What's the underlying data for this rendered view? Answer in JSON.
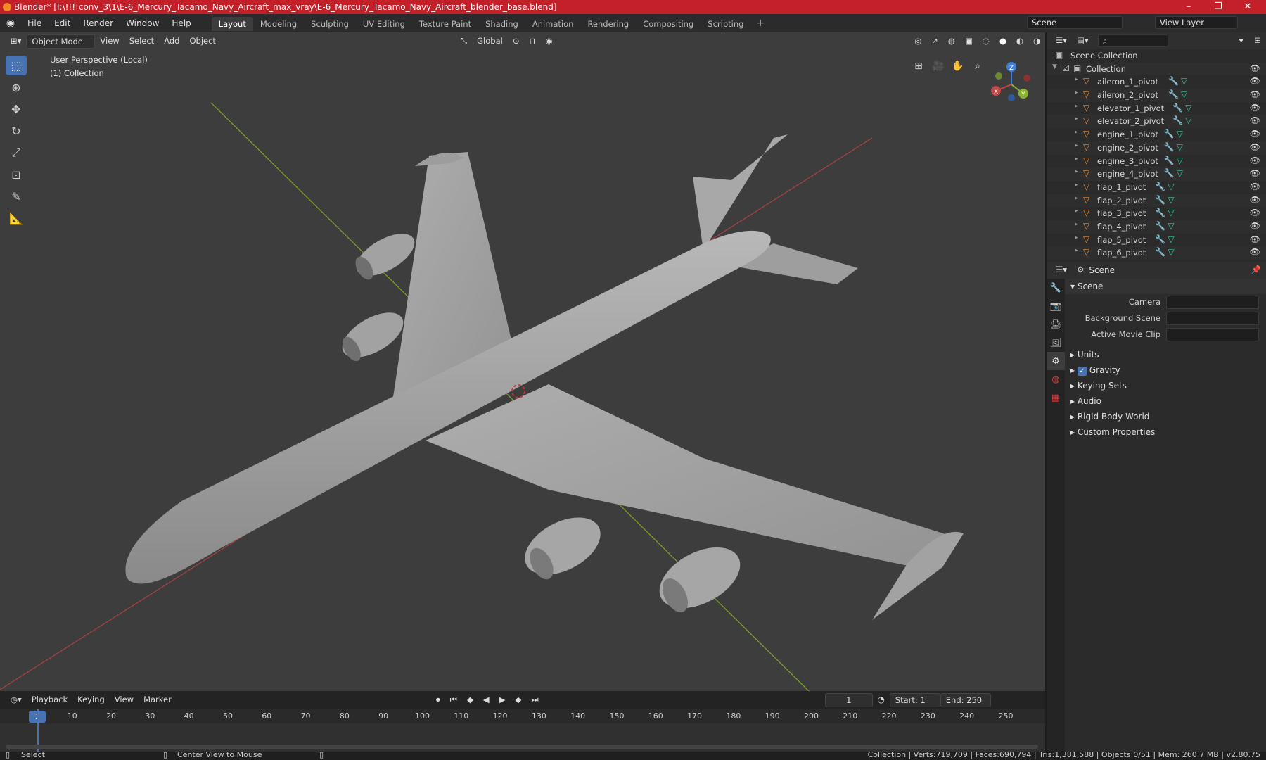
{
  "window": {
    "title": "Blender* [I:\\!!!!conv_3\\1\\E-6_Mercury_Tacamo_Navy_Aircraft_max_vray\\E-6_Mercury_Tacamo_Navy_Aircraft_blender_base.blend]",
    "controls": [
      "–",
      "❐",
      "✕"
    ]
  },
  "menubar": {
    "menus": [
      "File",
      "Edit",
      "Render",
      "Window",
      "Help"
    ],
    "workspaces": [
      "Layout",
      "Modeling",
      "Sculpting",
      "UV Editing",
      "Texture Paint",
      "Shading",
      "Animation",
      "Rendering",
      "Compositing",
      "Scripting"
    ],
    "active_workspace": "Layout",
    "scene_field": "Scene",
    "view_layer_field": "View Layer"
  },
  "viewport_header": {
    "mode": "Object Mode",
    "menus": [
      "View",
      "Select",
      "Add",
      "Object"
    ],
    "transform_orientation": "Global"
  },
  "viewport": {
    "perspective_label": "User Perspective (Local)",
    "collection_label": "(1) Collection",
    "gizmo_axes": {
      "x": "X",
      "y": "Y",
      "z": "Z"
    }
  },
  "toolbar": {
    "tools": [
      "select-box",
      "cursor",
      "move",
      "rotate",
      "scale",
      "transform",
      "annotate",
      "measure"
    ]
  },
  "outliner": {
    "root": "Scene Collection",
    "collection": "Collection",
    "items": [
      "aileron_1_pivot",
      "aileron_2_pivot",
      "elevator_1_pivot",
      "elevator_2_pivot",
      "engine_1_pivot",
      "engine_2_pivot",
      "engine_3_pivot",
      "engine_4_pivot",
      "flap_1_pivot",
      "flap_2_pivot",
      "flap_3_pivot",
      "flap_4_pivot",
      "flap_5_pivot",
      "flap_6_pivot"
    ]
  },
  "properties": {
    "context": "Scene",
    "section": "Scene",
    "fields": [
      {
        "label": "Camera"
      },
      {
        "label": "Background Scene"
      },
      {
        "label": "Active Movie Clip"
      }
    ],
    "subsections": [
      "Units",
      "Gravity",
      "Keying Sets",
      "Audio",
      "Rigid Body World",
      "Custom Properties"
    ],
    "gravity_checked": true
  },
  "timeline": {
    "menus": [
      "Playback",
      "Keying",
      "View",
      "Marker"
    ],
    "current_frame": "1",
    "start_label": "Start:",
    "start_value": "1",
    "end_label": "End:",
    "end_value": "250",
    "ruler": [
      "1",
      "10",
      "20",
      "30",
      "40",
      "50",
      "60",
      "70",
      "80",
      "90",
      "100",
      "110",
      "120",
      "130",
      "140",
      "150",
      "160",
      "170",
      "180",
      "190",
      "200",
      "210",
      "220",
      "230",
      "240",
      "250"
    ]
  },
  "statusbar": {
    "left_action": "Select",
    "mid_action": "Center View to Mouse",
    "stats": "Collection | Verts:719,709 | Faces:690,794 | Tris:1,381,588 | Objects:0/51 | Mem: 260.7 MB | v2.80.75"
  },
  "colors": {
    "title_bar": "#c3202a",
    "accent": "#4772b3",
    "viewport_bg": "#3d3d3d",
    "axis_x": "#c64545",
    "axis_y": "#8bb22f",
    "axis_z": "#3f7fdc",
    "object_icon": "#e8913a",
    "modifier_icon": "#6fa0e0",
    "mesh_icon": "#39c69a"
  }
}
